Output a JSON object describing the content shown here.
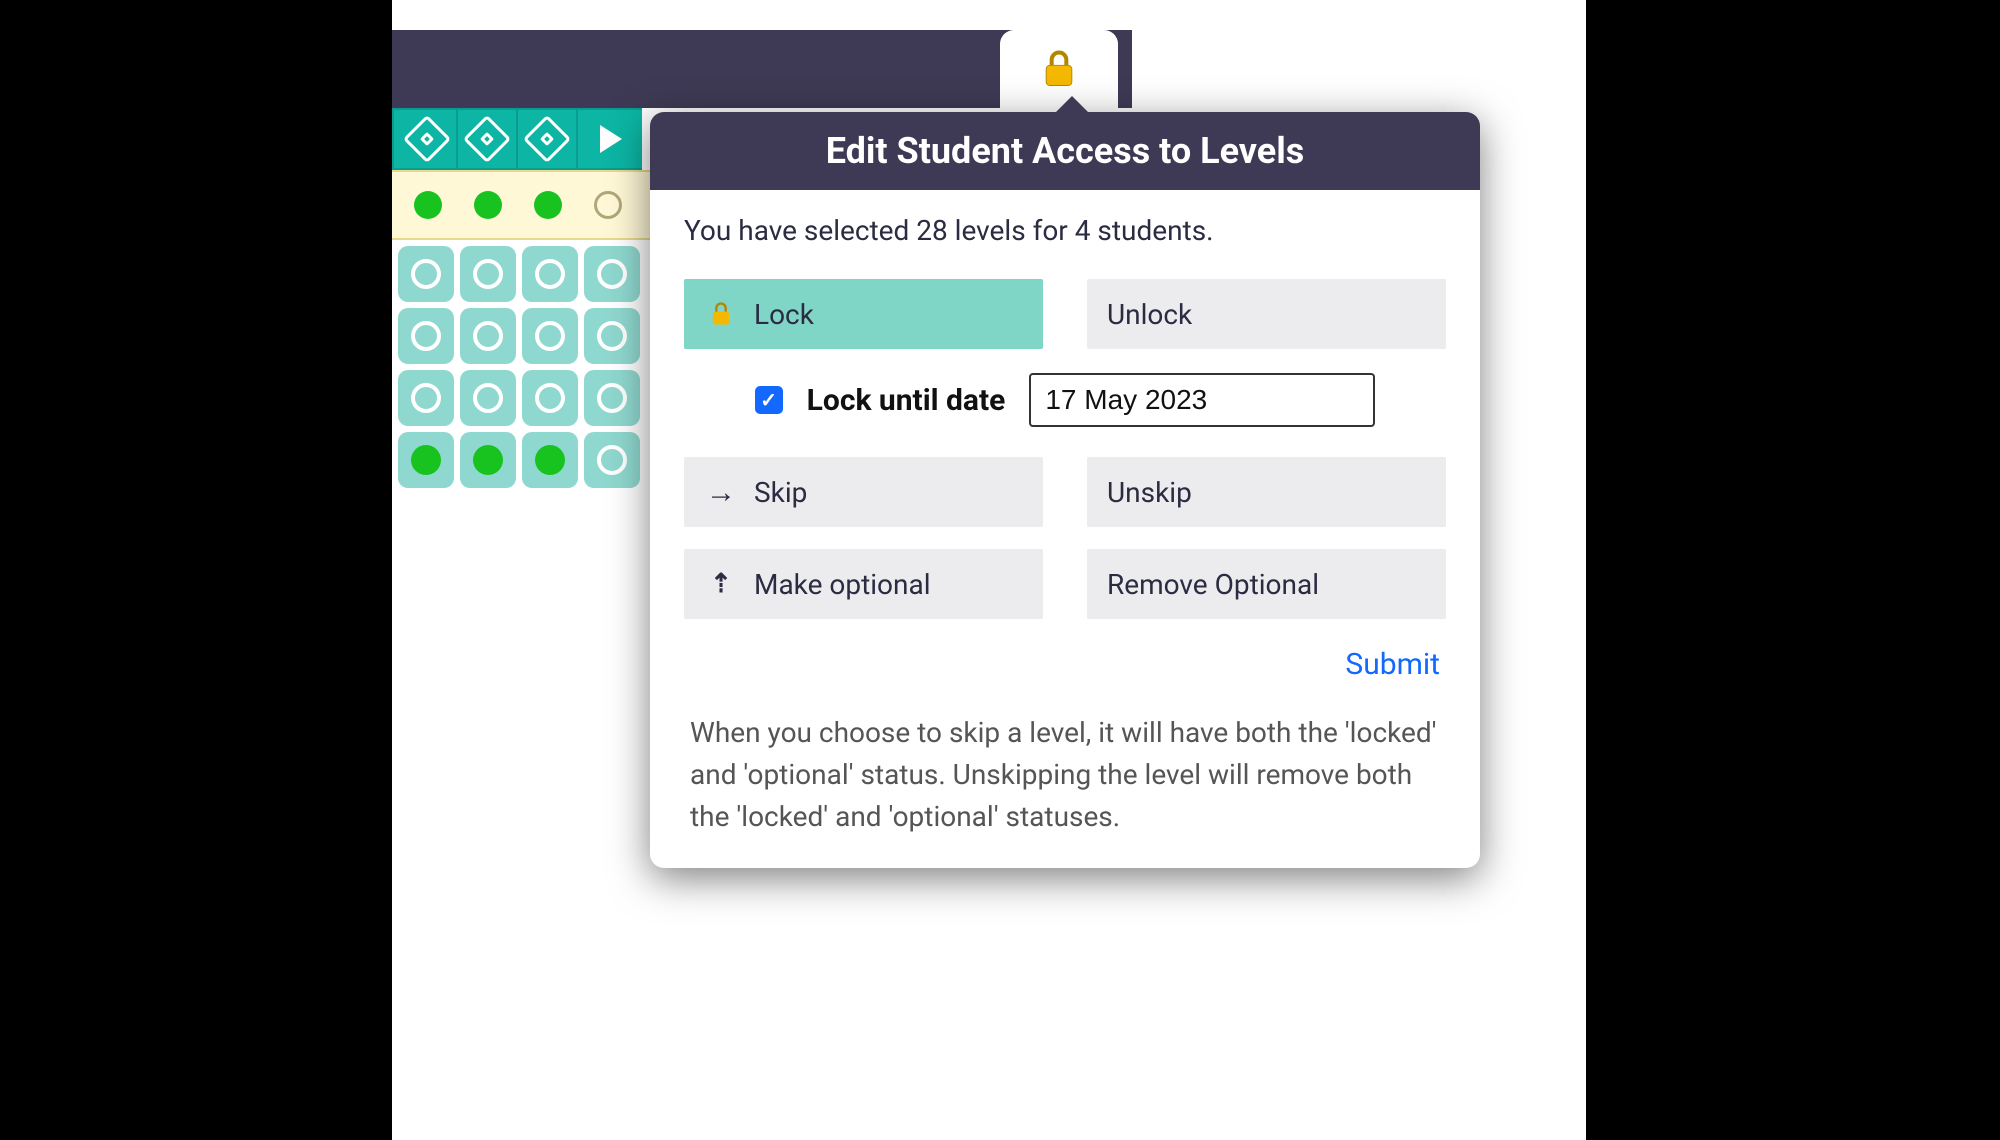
{
  "colors": {
    "header_dark": "#3e3a55",
    "teal": "#0cb5a4",
    "teal_light": "#8fd8cf",
    "selected_teal": "#7fd6c6",
    "link_blue": "#1268ff",
    "green_dot": "#18c31f"
  },
  "toolbar": {
    "lock_tab_icon": "lock-icon"
  },
  "selection_row": {
    "dots": [
      "green",
      "green",
      "green",
      "hollow"
    ]
  },
  "student_grid": {
    "rows": [
      [
        "ring",
        "ring",
        "ring",
        "ring"
      ],
      [
        "ring",
        "ring",
        "ring",
        "ring"
      ],
      [
        "ring",
        "ring",
        "ring",
        "ring"
      ],
      [
        "fill",
        "fill",
        "fill",
        "ring"
      ]
    ]
  },
  "popover": {
    "title": "Edit Student Access to Levels",
    "selected_text": "You have selected 28 levels for 4 students.",
    "options": {
      "lock": "Lock",
      "unlock": "Unlock",
      "skip": "Skip",
      "unskip": "Unskip",
      "make_optional": "Make optional",
      "remove_optional": "Remove Optional"
    },
    "lock_until": {
      "label": "Lock until date",
      "checked": true,
      "date": "17 May 2023"
    },
    "submit": "Submit",
    "help_text": "When you choose to skip a level, it will have both the 'locked' and 'optional' status. Unskipping the level will remove both the 'locked' and 'optional' statuses."
  }
}
